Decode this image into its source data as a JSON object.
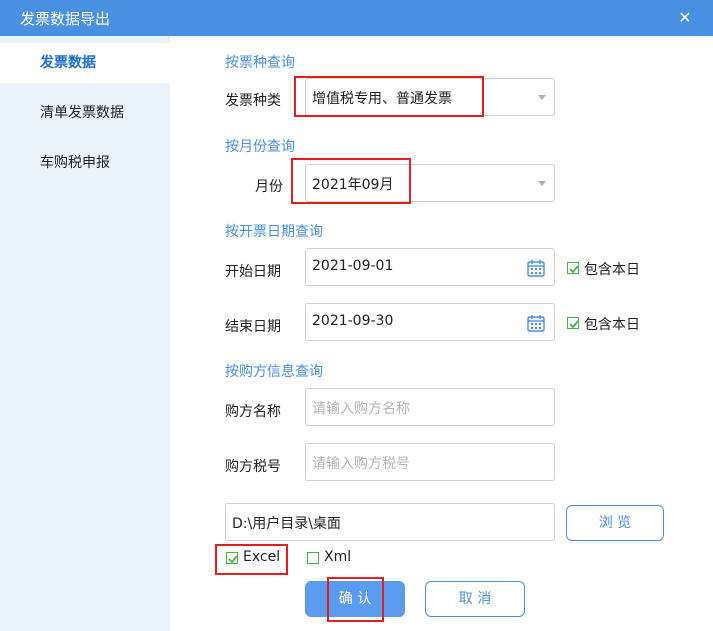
{
  "window": {
    "title": "发票数据导出",
    "close_icon": "close-icon"
  },
  "sidebar": {
    "items": [
      {
        "label": "发票数据",
        "active": true
      },
      {
        "label": "清单发票数据",
        "active": false
      },
      {
        "label": "车购税申报",
        "active": false
      }
    ]
  },
  "sections": {
    "by_type": "按票种查询",
    "by_month": "按月份查询",
    "by_date": "按开票日期查询",
    "by_buyer": "按购方信息查询"
  },
  "form": {
    "ticket_type_label": "发票种类",
    "ticket_type_value": "增值税专用、普通发票",
    "month_label": "月份",
    "month_value": "2021年09月",
    "start_label": "开始日期",
    "start_value": "2021-09-01",
    "end_label": "结束日期",
    "end_value": "2021-09-30",
    "include_today": "包含本日",
    "buyer_name_label": "购方名称",
    "buyer_name_placeholder": "请输入购方名称",
    "buyer_tax_label": "购方税号",
    "buyer_tax_placeholder": "请输入购方税号",
    "path_value": "D:\\用户目录\\桌面",
    "browse_label": "浏 览",
    "excel_label": "Excel",
    "excel_checked": true,
    "xml_label": "Xml",
    "xml_checked": false,
    "confirm_label": "确 认",
    "cancel_label": "取 消"
  },
  "colors": {
    "accent": "#4a90e2",
    "highlight": "#e02020",
    "check": "#4caf50"
  }
}
